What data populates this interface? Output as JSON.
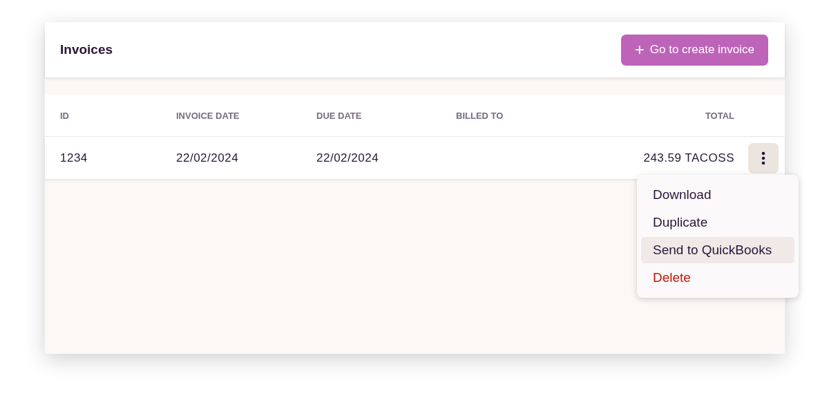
{
  "header": {
    "title": "Invoices",
    "create_button": {
      "icon": "+",
      "label": "Go to create invoice"
    }
  },
  "table": {
    "columns": [
      {
        "label": "ID"
      },
      {
        "label": "INVOICE DATE"
      },
      {
        "label": "DUE DATE"
      },
      {
        "label": "BILLED TO"
      },
      {
        "label": "TOTAL"
      }
    ],
    "rows": [
      {
        "cells": [
          "1234",
          "22/02/2024",
          "22/02/2024",
          "",
          "243.59 TACOSS"
        ],
        "menu_open": true
      }
    ]
  },
  "row_menu": {
    "items": [
      {
        "label": "Download",
        "kind": "normal",
        "highlighted": false
      },
      {
        "label": "Duplicate",
        "kind": "normal",
        "highlighted": false
      },
      {
        "label": "Send to QuickBooks",
        "kind": "normal",
        "highlighted": true
      },
      {
        "label": "Delete",
        "kind": "danger",
        "highlighted": false
      }
    ]
  }
}
